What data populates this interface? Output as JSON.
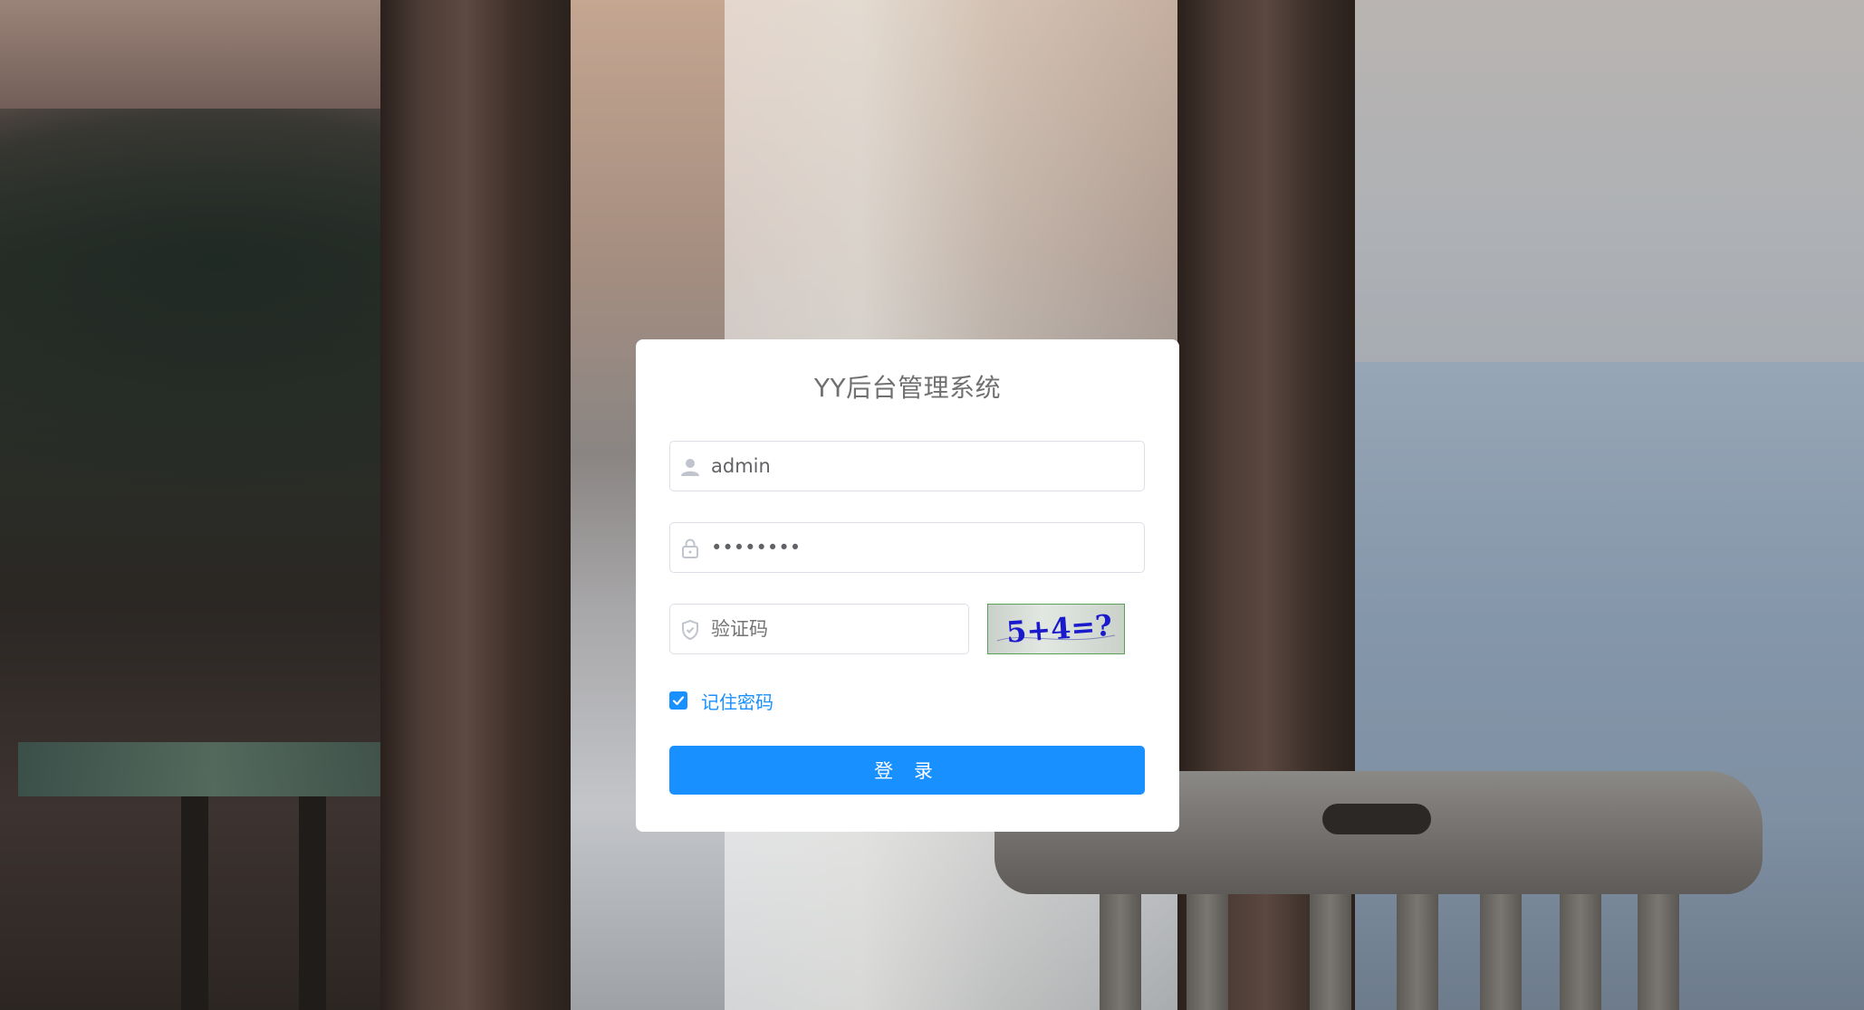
{
  "login": {
    "title": "YY后台管理系统",
    "username": {
      "value": "admin",
      "icon": "user-icon"
    },
    "password": {
      "value": "••••••••",
      "icon": "lock-icon"
    },
    "captcha": {
      "placeholder": "验证码",
      "icon": "shield-icon",
      "image_text": "5+4=?"
    },
    "remember": {
      "label": "记住密码",
      "checked": true
    },
    "submit_label": "登 录"
  },
  "colors": {
    "primary": "#1890ff",
    "card_bg": "#ffffff",
    "title_text": "#707070",
    "input_border": "#dcdfe6"
  }
}
